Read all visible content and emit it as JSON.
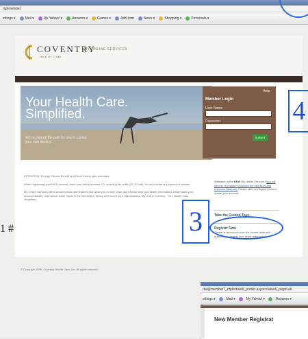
{
  "browser": {
    "address_fragment": "righmember",
    "toolbar_items": [
      "ettings ▾",
      "Mail ▾",
      "My Yahoo! ▾",
      "Answers ▾",
      "Games ▾",
      "Add Icon",
      "News ▾",
      "Shopping ▾",
      "Personals ▾"
    ]
  },
  "site": {
    "brand": "COVENTRY",
    "brand_sub": "Health Care",
    "services_label": "MY ONLINE SERVICES"
  },
  "hero": {
    "title_line1": "Your Health Care.",
    "title_line2": "Simplified.",
    "subtitle": "We've cleared the path for you to control your own destiny."
  },
  "login": {
    "help": "Help",
    "title": "Member Login",
    "username_label": "User Name",
    "password_label": "Password",
    "submit_label": "SUBMIT"
  },
  "main_text": {
    "attention": "ATTENTION: Foreign Service Benefit and Rural Carrier plan members:",
    "register_note": "When registering your MOS account, enter your entire member I.D. including the suffix (01, 02 etc). Do not include any spaces or dashes.",
    "services_note": "My Online Services offers secured tools and features that allow you to view, track and interact with your health information. Understand your account activity, read about health topics in the information library and record your vital statistics. My Online Services - Your Health Care. Simplified."
  },
  "sidebar": {
    "welcome_pre": "Welcome to the",
    "welcome_bold": "NEW",
    "welcome_post": "My Online Services!",
    "welcome_link": "You will need to re-register to access the new tools and enhanced features.",
    "welcome_tail": "Please click on Register Now to create your account.",
    "tour_title": "Take the Guided Tour",
    "register_title": "Register Now",
    "register_text": "Create an account to use the secure tools and features for viewing your health information."
  },
  "footer": {
    "copyright": "© Copyright 2006. Coventry Health Care, Inc. All rights reserved."
  },
  "annotations": {
    "callout_3": "3",
    "callout_4": "4",
    "side_fragment": "1 #"
  },
  "inset": {
    "address": "rtal@member?_nfpb=true&_portlet.async=false&_pageLab",
    "toolbar_items": [
      "ettings ▾",
      "Mail ▾",
      "My Yahoo! ▾",
      "Answers ▾"
    ],
    "title": "New Member Registrat"
  }
}
